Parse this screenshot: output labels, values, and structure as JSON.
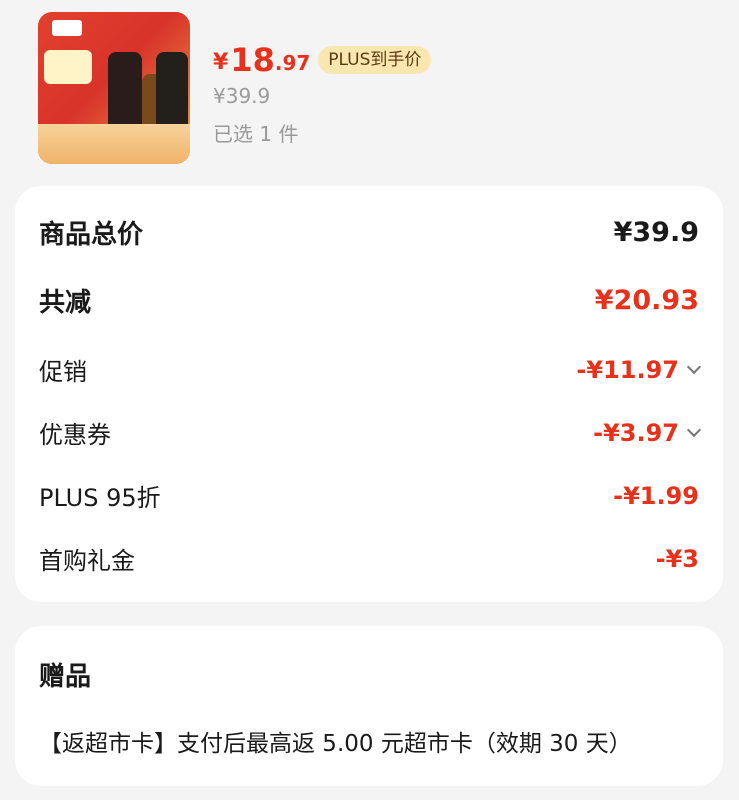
{
  "product": {
    "image_icon": "product-bottles-image",
    "price_symbol": "¥",
    "price_integer": "18",
    "price_decimal": ".97",
    "plus_badge": "PLUS到手价",
    "original_price": "¥39.9",
    "selected_count": "已选 1 件"
  },
  "summary": {
    "total_label": "商品总价",
    "total_value": "¥39.9",
    "discount_label": "共减",
    "discount_value": "¥20.93",
    "items": [
      {
        "label": "促销",
        "value": "-¥11.97",
        "expandable": true
      },
      {
        "label": "优惠券",
        "value": "-¥3.97",
        "expandable": true
      },
      {
        "label": "PLUS 95折",
        "value": "-¥1.99",
        "expandable": false
      },
      {
        "label": "首购礼金",
        "value": "-¥3",
        "expandable": false
      }
    ]
  },
  "gift": {
    "title": "赠品",
    "text": "【返超市卡】支付后最高返 5.00 元超市卡（效期 30 天）"
  },
  "colors": {
    "accent_red": "#e8311b",
    "plus_badge_bg": "#fae7b0"
  }
}
